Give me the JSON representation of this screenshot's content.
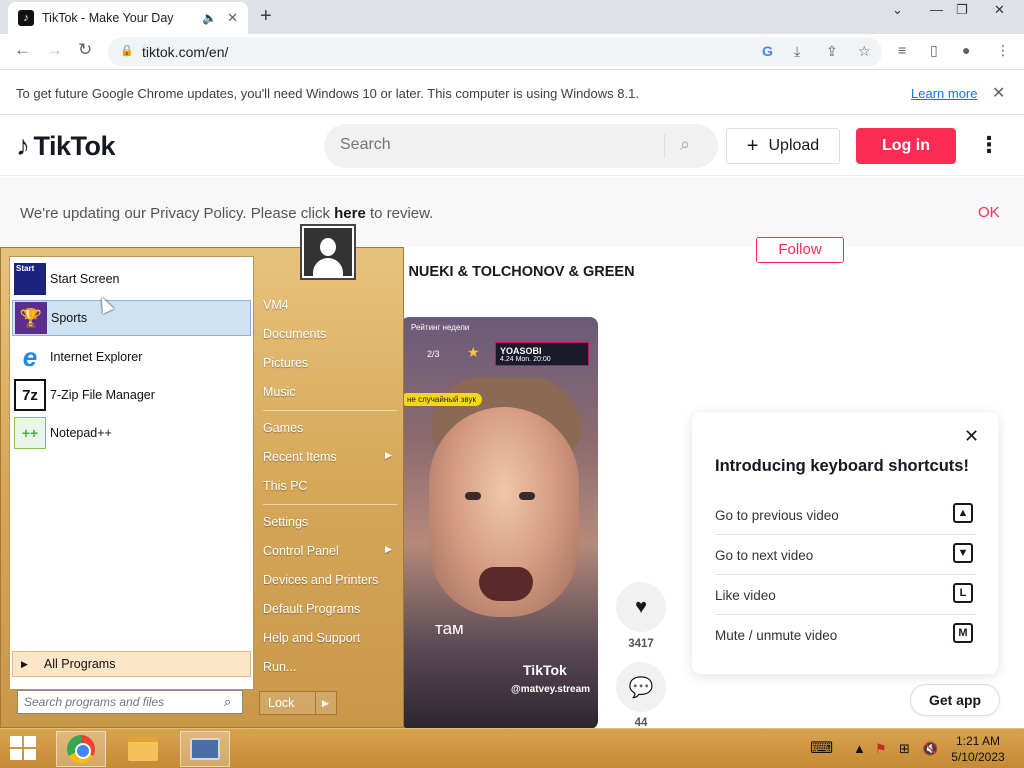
{
  "browser": {
    "tab_title": "TikTok - Make Your Day",
    "url": "tiktok.com/en/",
    "infobar_message": "To get future Google Chrome updates, you'll need Windows 10 or later. This computer is using Windows 8.1.",
    "infobar_link": "Learn more"
  },
  "tiktok": {
    "logo_text": "TikTok",
    "search_placeholder": "Search",
    "upload_label": "Upload",
    "login_label": "Log in",
    "privacy_prefix": "We're updating our Privacy Policy. Please click ",
    "privacy_here": "here",
    "privacy_suffix": " to review.",
    "privacy_ok": "OK",
    "follow_label": "Follow",
    "music_title": "TUTI TU - NUEKI & TOLCHONOV & GREEN",
    "video": {
      "rating_text": "Рейтинг недели",
      "counter": "2/3",
      "promo_title": "YOASOBI",
      "promo_date": "4.24 Mon.",
      "promo_time": "20:00",
      "sound_tag": "не случайный звук",
      "caption": "там",
      "watermark": "TikTok",
      "handle": "@matvey.stream"
    },
    "likes_count": "3417",
    "comments_count": "44",
    "shortcuts": {
      "title": "Introducing keyboard shortcuts!",
      "items": [
        {
          "label": "Go to previous video",
          "key": "▲"
        },
        {
          "label": "Go to next video",
          "key": "▼"
        },
        {
          "label": "Like video",
          "key": "L"
        },
        {
          "label": "Mute / unmute video",
          "key": "M"
        }
      ]
    },
    "get_app_label": "Get app"
  },
  "start_menu": {
    "pinned": [
      {
        "label": "Start Screen",
        "icon": "start-screen-icon"
      },
      {
        "label": "Sports",
        "icon": "trophy-icon"
      },
      {
        "label": "Internet Explorer",
        "icon": "internet-explorer-icon"
      },
      {
        "label": "7-Zip File Manager",
        "icon": "7zip-icon"
      },
      {
        "label": "Notepad++",
        "icon": "notepad-plus-plus-icon"
      }
    ],
    "start_icon_text": "Start",
    "all_programs": "All Programs",
    "search_placeholder": "Search programs and files",
    "right_items": [
      "VM4",
      "Documents",
      "Pictures",
      "Music",
      "Games",
      "Recent Items",
      "This PC",
      "Settings",
      "Control Panel",
      "Devices and Printers",
      "Default Programs",
      "Help and Support",
      "Run..."
    ],
    "lock_label": "Lock"
  },
  "taskbar": {
    "time": "1:21 AM",
    "date": "5/10/2023"
  }
}
